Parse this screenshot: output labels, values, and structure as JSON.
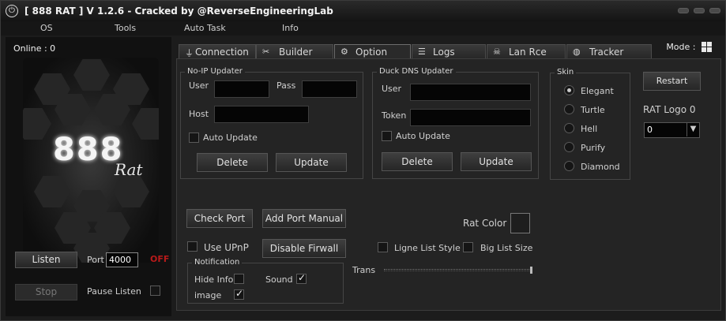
{
  "window": {
    "title": "[ 888 RAT  ] V 1.2.6 - Cracked by @ReverseEngineeringLab",
    "app_icon": "power-icon"
  },
  "menu": [
    "OS",
    "Tools",
    "Auto Task",
    "Info"
  ],
  "left": {
    "online_label": "Online : 0",
    "logo_text": "888",
    "logo_subtext": "Rat",
    "listen_label": "Listen",
    "stop_label": "Stop",
    "port_label": "Port",
    "port_value": "4000",
    "port_status": "OFF",
    "pause_label": "Pause Listen"
  },
  "tabs": [
    {
      "label": "Connection",
      "icon": "plug-icon"
    },
    {
      "label": "Builder",
      "icon": "tools-icon"
    },
    {
      "label": "Option",
      "icon": "gear-icon"
    },
    {
      "label": "Logs",
      "icon": "list-icon"
    },
    {
      "label": "Lan Rce",
      "icon": "skull-icon"
    },
    {
      "label": "Tracker",
      "icon": "globe-icon"
    }
  ],
  "mode_label": "Mode :",
  "noip": {
    "title": "No-IP Updater",
    "user_label": "User",
    "pass_label": "Pass",
    "host_label": "Host",
    "auto_update_label": "Auto Update",
    "delete_label": "Delete",
    "update_label": "Update"
  },
  "duckdns": {
    "title": "Duck DNS Updater",
    "user_label": "User",
    "token_label": "Token",
    "auto_update_label": "Auto Update",
    "delete_label": "Delete",
    "update_label": "Update"
  },
  "skin": {
    "title": "Skin",
    "options": [
      "Elegant",
      "Turtle",
      "Hell",
      "Purify",
      "Diamond"
    ],
    "selected": "Elegant"
  },
  "restart_label": "Restart",
  "rat_logo_label": "RAT Logo 0",
  "rat_logo_value": "0",
  "check_port_label": "Check Port",
  "add_port_label": "Add Port Manual",
  "use_upnp_label": "Use UPnP",
  "disable_firewall_label": "Disable Firwall",
  "rat_color_label": "Rat Color >",
  "ligne_list_label": "Ligne List Style",
  "big_list_label": "Big List Size",
  "notification": {
    "title": "Notification",
    "hide_info_label": "Hide Info",
    "sound_label": "Sound",
    "image_label": "image",
    "hide_info_checked": false,
    "sound_checked": true,
    "image_checked": true
  },
  "trans_label": "Trans",
  "trans_value": 1.0
}
